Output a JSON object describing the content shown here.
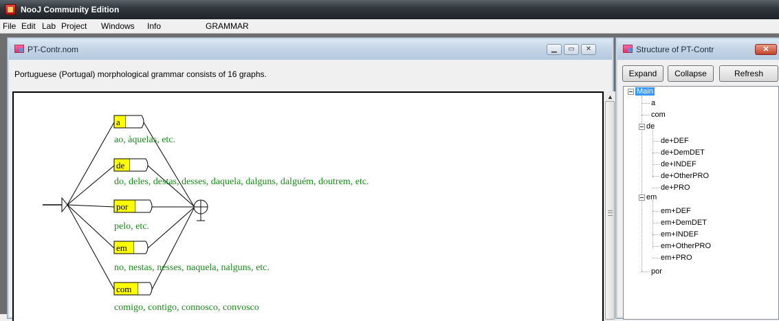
{
  "app": {
    "title": "NooJ Community Edition"
  },
  "menu": [
    "File",
    "Edit",
    "Lab",
    "Project",
    "Windows",
    "Info",
    "GRAMMAR"
  ],
  "grammar_window": {
    "title": "PT-Contr.nom",
    "description": "Portuguese (Portugal) morphological grammar consists of 16 graphs.",
    "nodes": [
      {
        "label": "a",
        "comment": "ao, àquelas, etc."
      },
      {
        "label": "de",
        "comment": "do, deles, destas, desses, daquela, dalguns, dalguém, doutrem, etc."
      },
      {
        "label": "por",
        "comment": "pelo, etc."
      },
      {
        "label": "em",
        "comment": "no, nestas, nesses, naquela, nalguns, etc."
      },
      {
        "label": "com",
        "comment": "comigo, contigo, connosco, convosco"
      }
    ]
  },
  "structure_window": {
    "title": "Structure of PT-Contr",
    "buttons": {
      "expand": "Expand",
      "collapse": "Collapse",
      "refresh": "Refresh"
    },
    "tree": {
      "root": "Main",
      "a": "a",
      "com": "com",
      "de": "de",
      "de_children": [
        "de+DEF",
        "de+DemDET",
        "de+INDEF",
        "de+OtherPRO",
        "de+PRO"
      ],
      "em": "em",
      "em_children": [
        "em+DEF",
        "em+DemDET",
        "em+INDEF",
        "em+OtherPRO",
        "em+PRO"
      ],
      "por": "por"
    }
  },
  "colors": {
    "node_fill": "#ffff00",
    "comment_text": "#1a8a1a",
    "selection": "#3399ff"
  }
}
